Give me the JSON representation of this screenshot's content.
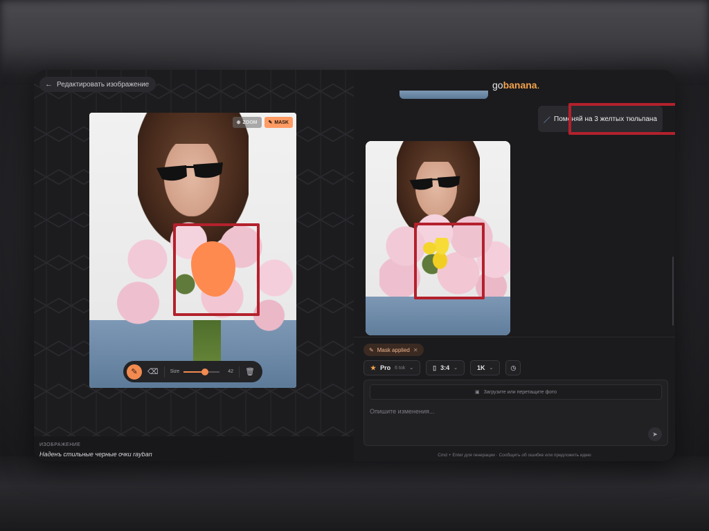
{
  "left": {
    "back_label": "Редактировать изображение",
    "zoom_label": "ZOOM",
    "mask_label": "MASK",
    "toolbar": {
      "size_label": "Size",
      "size_value": "42",
      "size_fraction": 0.6
    },
    "caption_label": "ИЗОБРАЖЕНИЕ",
    "caption_text": "Наденъ стильные черные очки rayban"
  },
  "right": {
    "logo_prefix": "go",
    "logo_brand": "banana",
    "logo_dot": ".",
    "user_message": "Поменяй на 3 желтых тюльпана",
    "mask_chip": "Mask applied",
    "options": {
      "model": "Pro",
      "model_sub": "6 tok",
      "ratio": "3:4",
      "resolution": "1K"
    },
    "upload_label": "Загрузите или перетащите фото",
    "input_placeholder": "Опишите изменения...",
    "footer_hint": "Cmd + Enter для генерации · Сообщить об ошибке или предложить идею"
  },
  "colors": {
    "accent": "#f38a4f",
    "brand": "#f4a34b",
    "highlight_box": "#b3212c"
  }
}
